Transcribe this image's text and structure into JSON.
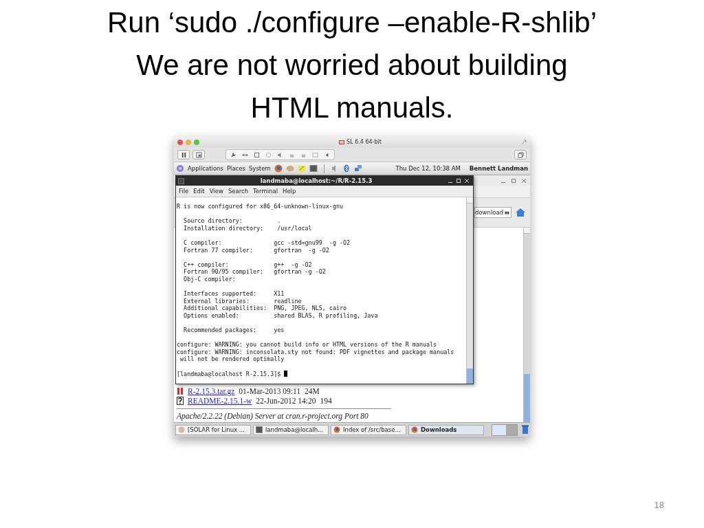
{
  "slide": {
    "title_lines": [
      "Run ‘sudo ./configure –enable-R-shlib’",
      "We are not worried about building",
      "HTML manuals."
    ],
    "page_number": "18"
  },
  "vm_window": {
    "title": "SL 6.4 64-bit"
  },
  "panel": {
    "menus": [
      "Applications",
      "Places",
      "System"
    ],
    "clock": "Thu Dec 12, 10:38 AM",
    "user": "Bennett Landman"
  },
  "terminal": {
    "title": "landmaba@localhost:~/R/R-2.15.3",
    "menus": [
      "File",
      "Edit",
      "View",
      "Search",
      "Terminal",
      "Help"
    ],
    "blocks": [
      [
        "R is now configured for x86_64-unknown-linux-gnu"
      ],
      [
        "  Source directory:          .",
        "  Installation directory:    /usr/local"
      ],
      [
        "  C compiler:               gcc -std=gnu99  -g -O2",
        "  Fortran 77 compiler:      gfortran  -g -O2"
      ],
      [
        "  C++ compiler:             g++  -g -O2",
        "  Fortran 90/95 compiler:   gfortran -g -O2",
        "  Obj-C compiler:"
      ],
      [
        "  Interfaces supported:     X11",
        "  External libraries:       readline",
        "  Additional capabilities:  PNG, JPEG, NLS, cairo",
        "  Options enabled:          shared BLAS, R profiling, Java"
      ],
      [
        "  Recommended packages:     yes"
      ],
      [
        "configure: WARNING: you cannot build info or HTML versions of the R manuals",
        "configure: WARNING: inconsolata.sty not found: PDF vignettes and package manuals",
        " will not be rendered optimally"
      ]
    ],
    "prompt": "[landmaba@localhost R-2.15.3]$"
  },
  "browser": {
    "search": {
      "value": "download"
    },
    "rows": [
      {
        "kind": "archive",
        "name": "R-2.15.3.tar.gz",
        "date": "01-Mar-2013 09:11",
        "size": "24M"
      },
      {
        "kind": "unknown",
        "name": "README-2.15.1-w",
        "date": "22-Jun-2012 14:20",
        "size": "194"
      }
    ],
    "footer": "Apache/2.2.22 (Debian) Server at cran.r-project.org Port 80"
  },
  "taskbar": [
    {
      "label": "[SOLAR for Linux ...",
      "kind": "app",
      "selected": false
    },
    {
      "label": "landmaba@localh...",
      "kind": "terminal",
      "selected": false
    },
    {
      "label": "Index of /src/base...",
      "kind": "browser",
      "selected": false
    },
    {
      "label": "Downloads",
      "kind": "browser",
      "selected": true
    }
  ]
}
